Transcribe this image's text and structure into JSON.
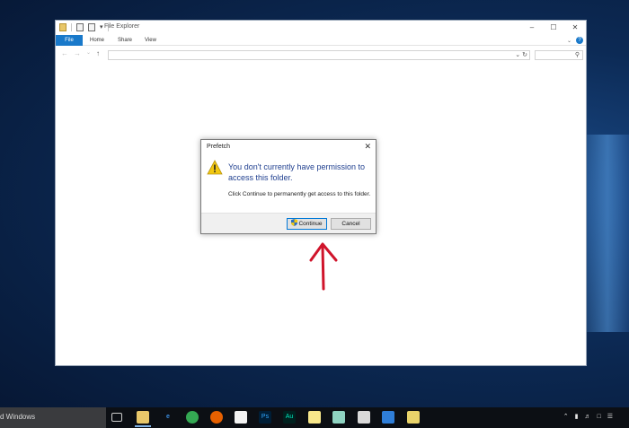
{
  "explorer": {
    "title": "File Explorer",
    "tabs": [
      "File",
      "Home",
      "Share",
      "View"
    ],
    "help_label": "?",
    "address_value": "",
    "search_placeholder": ""
  },
  "dialog": {
    "title": "Prefetch",
    "main_message": "You don't currently have permission to access this folder.",
    "sub_message": "Click Continue to permanently get access to this folder.",
    "continue_label": "Continue",
    "cancel_label": "Cancel"
  },
  "taskbar": {
    "search_text": "d Windows",
    "apps": [
      "task-view",
      "file-explorer",
      "edge",
      "chrome",
      "firefox",
      "store",
      "photoshop",
      "audition",
      "sticky-notes",
      "notepad",
      "calculator",
      "mail",
      "media-player"
    ],
    "tray": [
      "chevron-up",
      "battery",
      "volume",
      "message",
      "action-center"
    ]
  },
  "colors": {
    "accent": "#1979ca",
    "dialog_heading": "#1f3f8f",
    "annotation_arrow": "#d0142b"
  }
}
